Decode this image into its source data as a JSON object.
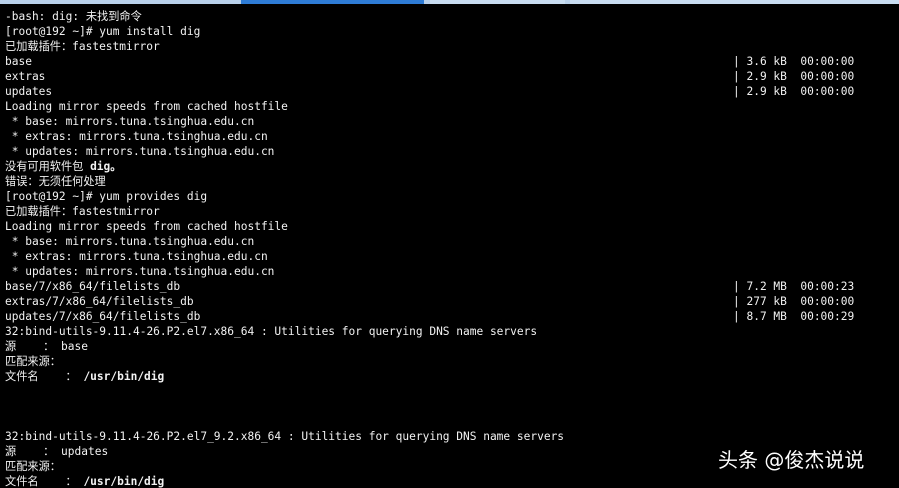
{
  "window": {
    "tabs_count": 3,
    "active_tab_index": 0,
    "tab_active_color": "#2e7cd6",
    "tab_inactive_color": "#c9ddf1"
  },
  "terminal": {
    "background": "#000000",
    "foreground": "#f2f2f2",
    "lines": {
      "l01": "-bash: dig: 未找到命令",
      "l02": "[root@192 ~]# yum install dig",
      "l03": "已加载插件：fastestmirror",
      "l04": "base",
      "l05": "extras",
      "l06": "updates",
      "l07": "Loading mirror speeds from cached hostfile",
      "l08": " * base: mirrors.tuna.tsinghua.edu.cn",
      "l09": " * extras: mirrors.tuna.tsinghua.edu.cn",
      "l10": " * updates: mirrors.tuna.tsinghua.edu.cn",
      "l11_prefix": "没有可用软件包 ",
      "l11_bold": "dig。",
      "l12": "错误：无须任何处理",
      "l13": "[root@192 ~]# yum provides dig",
      "l14": "已加载插件：fastestmirror",
      "l15": "Loading mirror speeds from cached hostfile",
      "l16": " * base: mirrors.tuna.tsinghua.edu.cn",
      "l17": " * extras: mirrors.tuna.tsinghua.edu.cn",
      "l18": " * updates: mirrors.tuna.tsinghua.edu.cn",
      "l19": "base/7/x86_64/filelists_db",
      "l20": "extras/7/x86_64/filelists_db",
      "l21": "updates/7/x86_64/filelists_db",
      "l22": "32:bind-utils-9.11.4-26.P2.el7.x86_64 : Utilities for querying DNS name servers",
      "l23": "源    ： base",
      "l24": "匹配来源：",
      "l25_prefix": "文件名    ： ",
      "l25_bold": "/usr/bin/dig",
      "l26": "32:bind-utils-9.11.4-26.P2.el7_9.2.x86_64 : Utilities for querying DNS name servers",
      "l27": "源    ： updates",
      "l28": "匹配来源：",
      "l29_prefix": "文件名    ： ",
      "l29_bold": "/usr/bin/dig"
    },
    "progress": {
      "r04": "| 3.6 kB  00:00:00",
      "r05": "| 2.9 kB  00:00:00",
      "r06": "| 2.9 kB  00:00:00",
      "r19": "| 7.2 MB  00:00:23",
      "r20": "| 277 kB  00:00:00",
      "r21": "| 8.7 MB  00:00:29"
    }
  },
  "watermark": {
    "text": "头条 @俊杰说说"
  }
}
